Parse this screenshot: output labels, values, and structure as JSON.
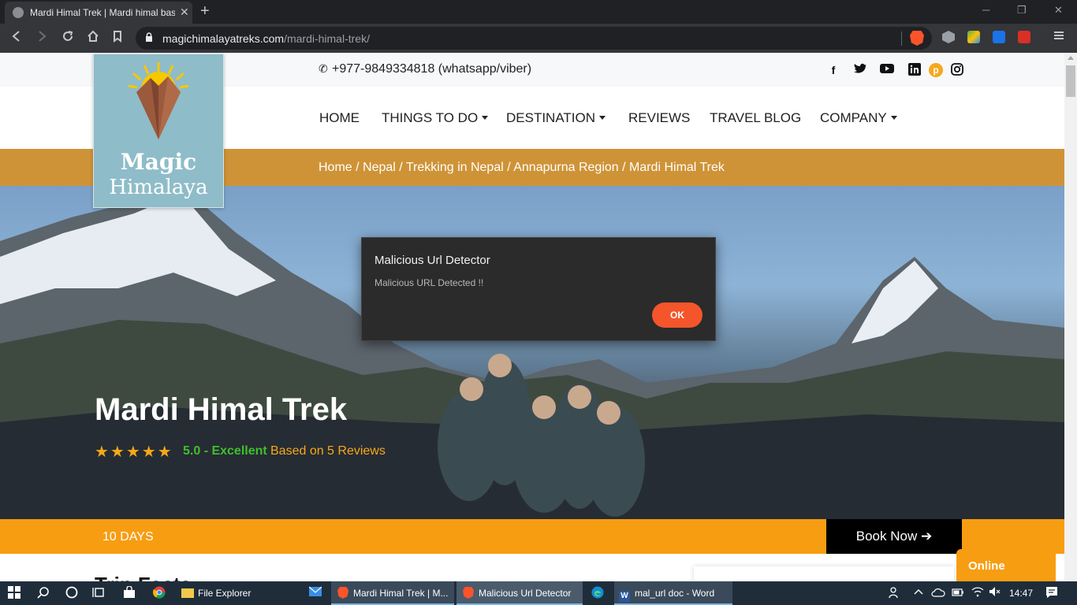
{
  "browser": {
    "tab_title": "Mardi Himal Trek | Mardi himal base camp",
    "tab_close": "✕",
    "new_tab": "+",
    "win_min": "─",
    "win_restore": "❐",
    "win_close": "✕",
    "url_domain": "magichimalayatreks.com",
    "url_path": "/mardi-himal-trek/"
  },
  "site": {
    "phone": "+977-9849334818 (whatsapp/viber)",
    "social_icons": [
      "facebook-icon",
      "twitter-icon",
      "youtube-icon",
      "linkedin-icon",
      "pinterest-icon",
      "instagram-icon"
    ],
    "logo_line1": "Magic",
    "logo_line2": "Himalaya",
    "nav": {
      "home": "HOME",
      "things": "THINGS TO DO",
      "destination": "DESTINATION",
      "reviews": "REVIEWS",
      "blog": "TRAVEL BLOG",
      "company": "COMPANY"
    },
    "breadcrumb": "Home / Nepal / Trekking in Nepal / Annapurna Region / Mardi Himal Trek",
    "hero": {
      "title": "Mardi Himal Trek",
      "stars": "★★★★★",
      "rating_value": 5.0,
      "rating_score": "5.0 - Excellent",
      "rating_based": "Based on 5 Reviews"
    },
    "duration": "10 DAYS",
    "book_now": "Book Now ➔",
    "trip_facts": "Trip Facts",
    "online": "Online"
  },
  "dialog": {
    "title": "Malicious Url Detector",
    "message": "Malicious URL Detected !!",
    "ok": "OK"
  },
  "taskbar": {
    "file_explorer": "File Explorer",
    "brave_window": "Mardi Himal Trek | M...",
    "detector_window": "Malicious Url Detector",
    "word_window": "mal_url doc - Word",
    "time": "14:47"
  },
  "colors": {
    "accent_orange": "#f79d12",
    "breadcrumb_bg": "#cf9337",
    "ok_button": "#f4552b",
    "rating_green": "#3fbf2e"
  }
}
